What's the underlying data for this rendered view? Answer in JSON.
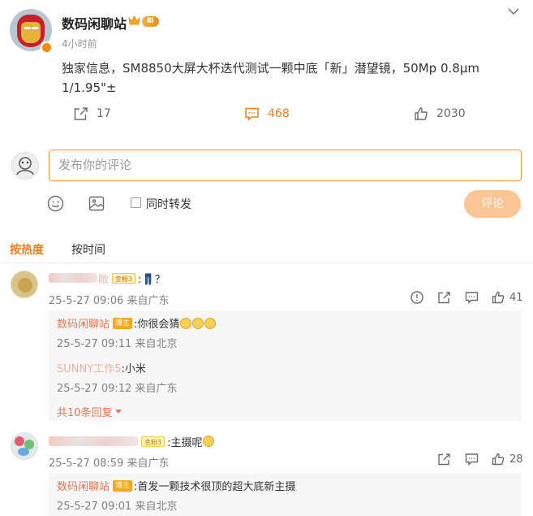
{
  "post": {
    "username": "数码闲聊站",
    "level_badge": "Ⅲ",
    "time": "4小时前",
    "text": "独家信息，SM8850大屏大杯迭代测试一颗中底「新」潜望镜，50Mp 0.8μm 1/1.95\"±",
    "actions": {
      "repost_count": "17",
      "comment_count": "468",
      "like_count": "2030"
    }
  },
  "composer": {
    "placeholder": "发布你的评论",
    "repost_label": "同时转发",
    "submit_label": "评论"
  },
  "sort": {
    "hot": "按热度",
    "time": "按时间"
  },
  "comments": [
    {
      "name_visible": "敞",
      "fan_badge": "金粉3",
      "text": ":👖？",
      "meta": "25-5-27 09:06 来自广东",
      "like_count": "41",
      "replies": [
        {
          "name": "数码闲聊站",
          "badge": "博主",
          "text": ":你很会猜",
          "meta": "25-5-27 09:11 来自北京"
        },
        {
          "name": "SUNNY工作5",
          "text": ":小米",
          "meta": "25-5-27 09:12 来自广东"
        }
      ],
      "more_replies": "共10条回复"
    },
    {
      "fan_badge": "金粉3",
      "text": ":主摄呢",
      "meta": "25-5-27 08:59 来自广东",
      "like_count": "28",
      "replies": [
        {
          "name": "数码闲聊站",
          "badge": "博主",
          "text": ":首发一颗技术很顶的超大底新主摄",
          "meta": "25-5-27 09:01 来自北京"
        }
      ]
    }
  ],
  "colors": {
    "accent": "#f27c1d",
    "name": "#eb7350",
    "submit_disabled": "#fbc595"
  }
}
